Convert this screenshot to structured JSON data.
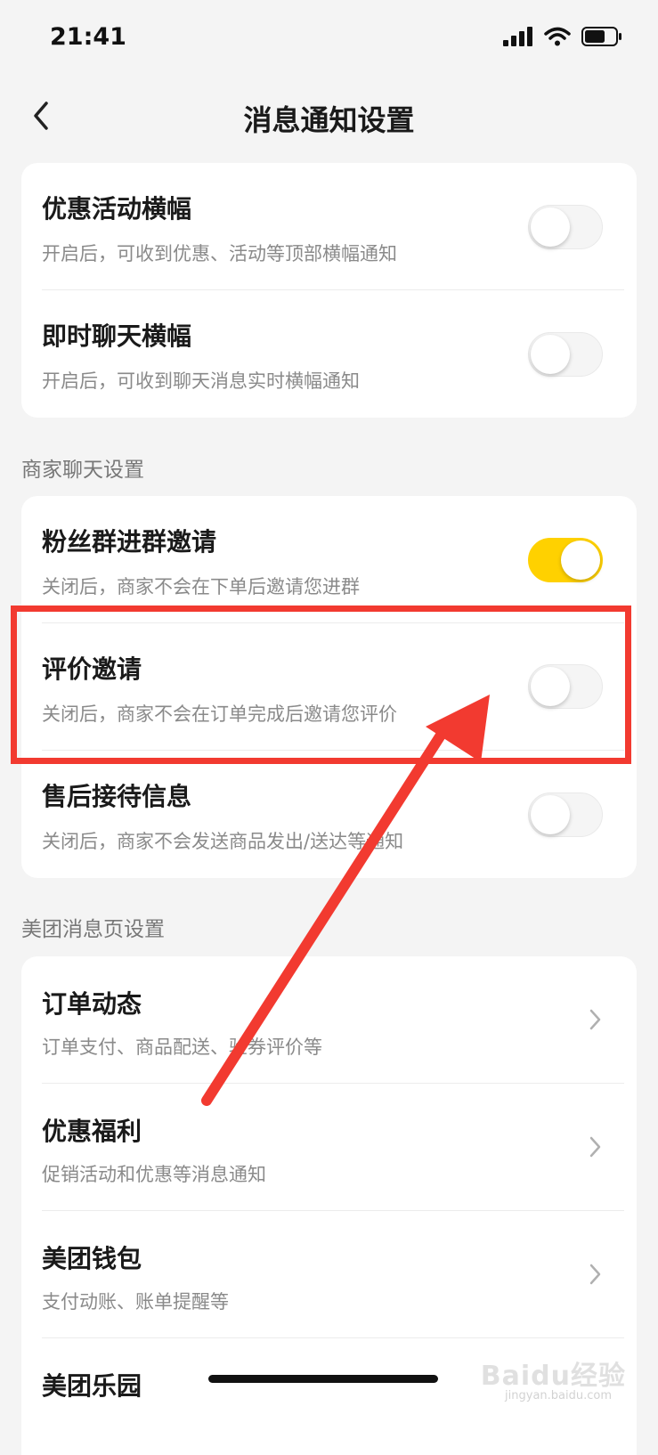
{
  "status_bar": {
    "time": "21:41"
  },
  "nav": {
    "title": "消息通知设置"
  },
  "cards": {
    "banner": {
      "rows": [
        {
          "title": "优惠活动横幅",
          "subtitle": "开启后，可收到优惠、活动等顶部横幅通知",
          "toggle": "off"
        },
        {
          "title": "即时聊天横幅",
          "subtitle": "开启后，可收到聊天消息实时横幅通知",
          "toggle": "off"
        }
      ]
    },
    "merchant": {
      "section_label": "商家聊天设置",
      "rows": [
        {
          "title": "粉丝群进群邀请",
          "subtitle": "关闭后，商家不会在下单后邀请您进群",
          "toggle": "on"
        },
        {
          "title": "评价邀请",
          "subtitle": "关闭后，商家不会在订单完成后邀请您评价",
          "toggle": "off"
        },
        {
          "title": "售后接待信息",
          "subtitle": "关闭后，商家不会发送商品发出/送达等通知",
          "toggle": "off"
        }
      ]
    },
    "meituan": {
      "section_label": "美团消息页设置",
      "rows": [
        {
          "title": "订单动态",
          "subtitle": "订单支付、商品配送、验券评价等"
        },
        {
          "title": "优惠福利",
          "subtitle": "促销活动和优惠等消息通知"
        },
        {
          "title": "美团钱包",
          "subtitle": "支付动账、账单提醒等"
        },
        {
          "title": "美团乐园",
          "subtitle": ""
        }
      ]
    }
  },
  "watermark": {
    "text": "Baidu经验",
    "sub": "jingyan.baidu.com"
  },
  "colors": {
    "toggle_on": "#ffd100",
    "highlight": "#f23a30",
    "background": "#f4f4f4"
  }
}
